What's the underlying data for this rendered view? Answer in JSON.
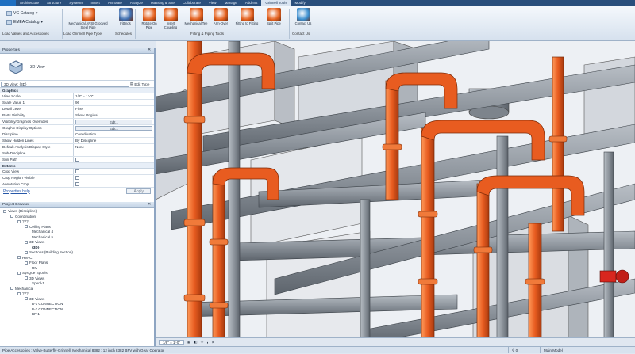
{
  "menu_tabs": [
    "Architecture",
    "Structure",
    "Systems",
    "Insert",
    "Annotate",
    "Analyze",
    "Massing & Site",
    "Collaborate",
    "View",
    "Manage",
    "Add-Ins",
    "Grinnell Tools",
    "Modify"
  ],
  "ribbon": {
    "dropdown1": "VG Catalog",
    "dropdown2": "EMEA Catalog",
    "buttons": [
      {
        "label": "Mechanical ANSI Grooved Steel Pipe",
        "name": "mechanical-ansi-button",
        "color": "#e5621f"
      },
      {
        "label": "Fittings",
        "name": "fittings-button",
        "color": "#3f6fb0"
      },
      {
        "label": "Rotate On Pipe",
        "name": "rotate-on-pipe-button",
        "color": "#e5621f"
      },
      {
        "label": "Insert Coupling",
        "name": "insert-coupling-button",
        "color": "#e5621f"
      },
      {
        "label": "Mechanical Tee",
        "name": "mechanical-tee-button",
        "color": "#e5621f"
      },
      {
        "label": "Arm-Over",
        "name": "arm-over-button",
        "color": "#e5621f"
      },
      {
        "label": "Fitting to Fitting",
        "name": "fitting-to-fitting-button",
        "color": "#e5621f"
      },
      {
        "label": "Split Pipe",
        "name": "split-pipe-button",
        "color": "#e5621f"
      },
      {
        "label": "Contact Us",
        "name": "contact-us-button",
        "color": "#3a8ecf"
      }
    ],
    "groups": [
      "Load Values and Accessories",
      "Load Grinnell Pipe Type",
      "Schedules",
      "Fitting & Piping Tools",
      "Contact Us"
    ]
  },
  "properties": {
    "title": "Properties",
    "type_name": "3D View",
    "selector": "3D View: {3D}",
    "edit_type": "Edit Type",
    "graphics_header": "Graphics",
    "rows": [
      {
        "k": "View Scale",
        "v": "1/8\" = 1'-0\""
      },
      {
        "k": "Scale Value   1:",
        "v": "96"
      },
      {
        "k": "Detail Level",
        "v": "Fine"
      },
      {
        "k": "Parts Visibility",
        "v": "Show Original"
      },
      {
        "k": "Visibility/Graphics Overrides",
        "v": "Edit...",
        "btn": true
      },
      {
        "k": "Graphic Display Options",
        "v": "Edit...",
        "btn": true
      },
      {
        "k": "Discipline",
        "v": "Coordination"
      },
      {
        "k": "Show Hidden Lines",
        "v": "By Discipline"
      },
      {
        "k": "Default Analysis Display Style",
        "v": "None"
      },
      {
        "k": "Sub-Discipline",
        "v": ""
      },
      {
        "k": "Sun Path",
        "v": "",
        "chk": true
      }
    ],
    "extents_header": "Extents",
    "extents": [
      {
        "k": "Crop View",
        "v": "",
        "chk": true
      },
      {
        "k": "Crop Region Visible",
        "v": "",
        "chk": true
      },
      {
        "k": "Annotation Crop",
        "v": "",
        "chk": true
      }
    ],
    "help_link": "Properties help",
    "apply": "Apply"
  },
  "browser": {
    "title": "Project Browser",
    "items": [
      {
        "t": "Views (Discipline)",
        "d": 0
      },
      {
        "t": "Coordination",
        "d": 1
      },
      {
        "t": "???",
        "d": 2
      },
      {
        "t": "Ceiling Plans",
        "d": 3
      },
      {
        "t": "Mechanical 4",
        "d": 4
      },
      {
        "t": "Mechanical 5",
        "d": 4
      },
      {
        "t": "3D Views",
        "d": 3
      },
      {
        "t": "{3D}",
        "d": 4,
        "bold": true
      },
      {
        "t": "Sections (Building Section)",
        "d": 3
      },
      {
        "t": "HVAC",
        "d": 2
      },
      {
        "t": "Floor Plans",
        "d": 3
      },
      {
        "t": "RM",
        "d": 4
      },
      {
        "t": "SysQue Spools",
        "d": 2
      },
      {
        "t": "3D Views",
        "d": 3
      },
      {
        "t": "Spool-1",
        "d": 4
      },
      {
        "t": "Mechanical",
        "d": 1
      },
      {
        "t": "???",
        "d": 2
      },
      {
        "t": "3D Views",
        "d": 3
      },
      {
        "t": "B-1 CONNECTION",
        "d": 4
      },
      {
        "t": "B-2 CONNECTION",
        "d": 4
      },
      {
        "t": "BF-1",
        "d": 4
      }
    ]
  },
  "viewbar": {
    "scale": "1/8\" = 1'-0\""
  },
  "status": {
    "text": "Pipe Accessories : Valve-Butterfly-Grinnell_Mechanical 8382 : 12 inch 8382 BFV with Gear Operator",
    "model": "Main Model"
  },
  "colors": {
    "pipe_orange": "#e85c20",
    "pipe_gray": "#8f969e",
    "duct_gray": "#c6cad0"
  }
}
